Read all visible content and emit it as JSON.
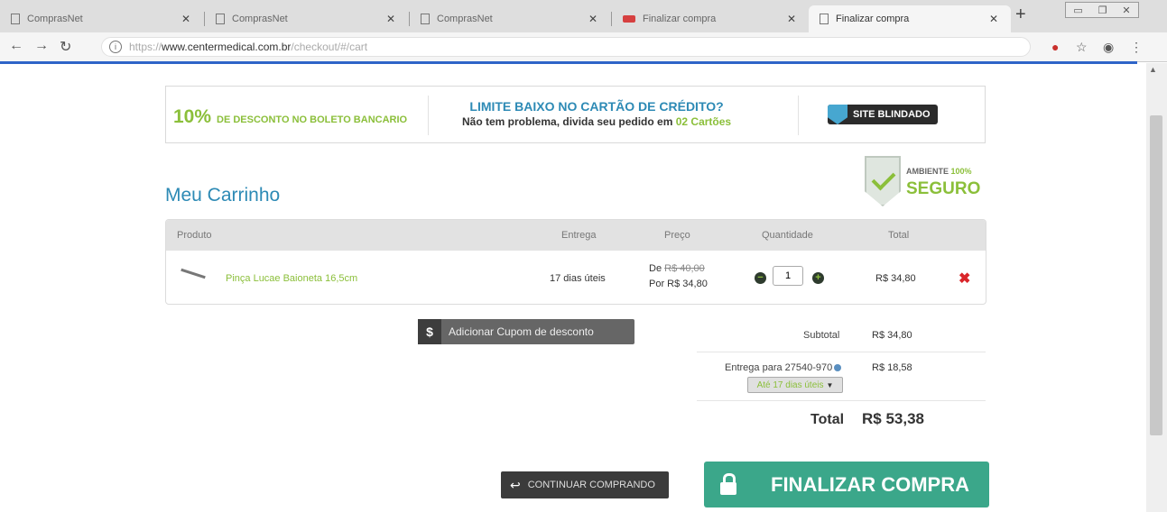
{
  "browser": {
    "tabs": [
      {
        "label": "ComprasNet",
        "active": false
      },
      {
        "label": "ComprasNet",
        "active": false
      },
      {
        "label": "ComprasNet",
        "active": false
      },
      {
        "label": "Finalizar compra",
        "active": false
      },
      {
        "label": "Finalizar compra",
        "active": true
      }
    ],
    "url_prefix": "https://",
    "url_domain": "www.centermedical.com.br",
    "url_path": "/checkout/#/cart"
  },
  "banner": {
    "discount_pct": "10%",
    "discount_text": "DE DESCONTO NO BOLETO BANCARIO",
    "limit_title": "LIMITE BAIXO NO CARTÃO DE CRÉDITO?",
    "limit_sub": "Não tem problema, divida seu pedido em",
    "limit_highlight": "02 Cartões",
    "blindado": "SITE BLINDADO"
  },
  "seguro": {
    "line1": "AMBIENTE",
    "line1_pct": "100%",
    "line2": "SEGURO"
  },
  "cart": {
    "title": "Meu Carrinho",
    "headers": {
      "produto": "Produto",
      "entrega": "Entrega",
      "preco": "Preço",
      "quantidade": "Quantidade",
      "total": "Total"
    },
    "item": {
      "name": "Pinça Lucae Baioneta 16,5cm",
      "delivery": "17 dias úteis",
      "price_from_label": "De",
      "price_from": "R$ 40,00",
      "price_to": "Por R$ 34,80",
      "quantity": "1",
      "total": "R$ 34,80"
    }
  },
  "coupon": {
    "label": "Adicionar Cupom de desconto"
  },
  "summary": {
    "subtotal_label": "Subtotal",
    "subtotal_value": "R$ 34,80",
    "shipping_label": "Entrega para 27540-970",
    "shipping_value": "R$ 18,58",
    "shipping_option": "Até 17 dias úteis",
    "total_label": "Total",
    "total_value": "R$ 53,38"
  },
  "actions": {
    "continue": "CONTINUAR COMPRANDO",
    "finalize": "FINALIZAR COMPRA"
  },
  "colors": {
    "accent_green": "#8bbf3a",
    "accent_blue": "#2d8ab5",
    "finalize_bg": "#3ba78a",
    "remove_red": "#d9252a"
  }
}
